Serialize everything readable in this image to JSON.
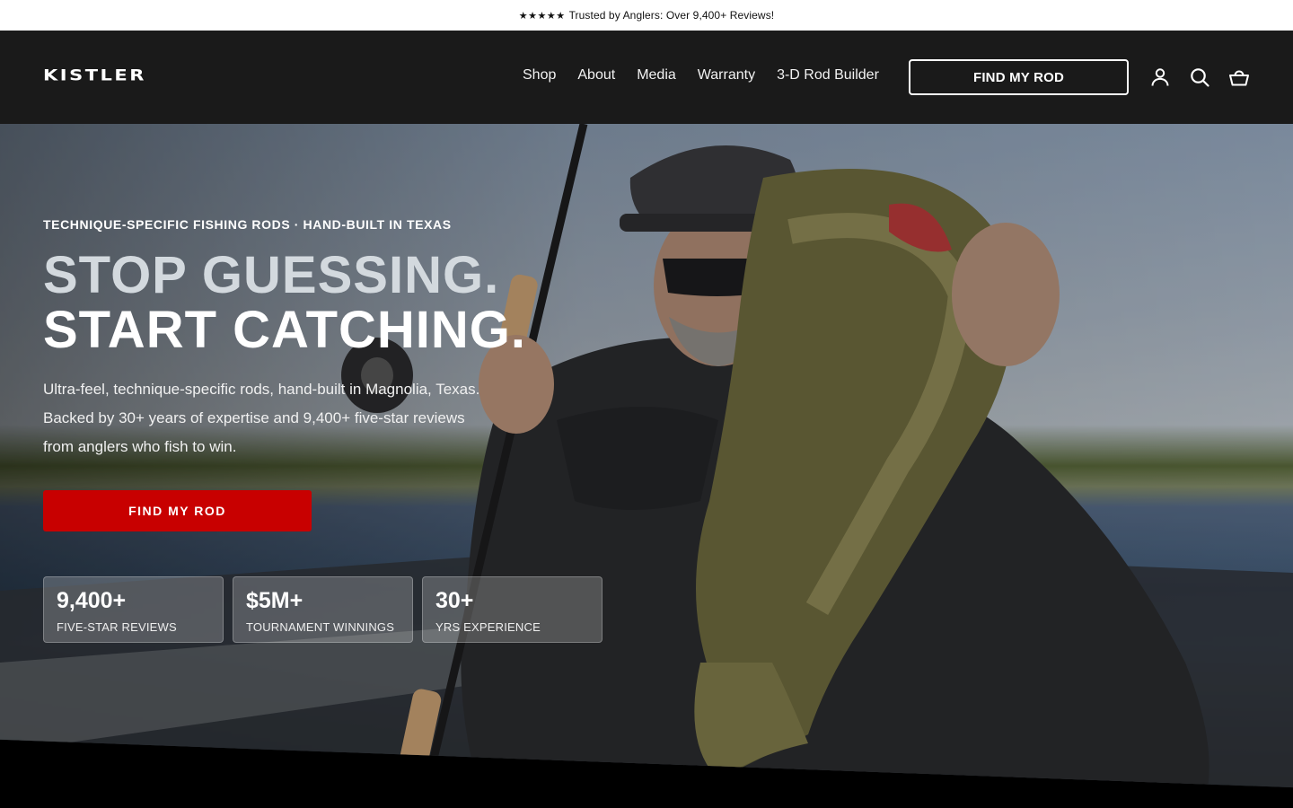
{
  "announcement": {
    "stars": "★★★★★",
    "text": "Trusted by Anglers: Over 9,400+ Reviews!"
  },
  "header": {
    "logo": "KISTLER",
    "nav": [
      {
        "label": "Shop"
      },
      {
        "label": "About"
      },
      {
        "label": "Media"
      },
      {
        "label": "Warranty"
      },
      {
        "label": "3-D Rod Builder"
      }
    ],
    "cta_label": "FIND MY ROD",
    "icons": [
      "account-icon",
      "search-icon",
      "cart-icon"
    ]
  },
  "hero": {
    "eyebrow": "TECHNIQUE-SPECIFIC FISHING RODS · HAND-BUILT IN TEXAS",
    "headline_line1": "STOP GUESSING.",
    "headline_line2": "START CATCHING.",
    "body": "Ultra-feel, technique-specific rods, hand-built in Magnolia, Texas. Backed by 30+ years of expertise and 9,400+ five-star reviews from anglers who fish to win.",
    "cta_label": "FIND MY ROD",
    "stats": [
      {
        "number": "9,400+",
        "label": "FIVE-STAR REVIEWS"
      },
      {
        "number": "$5M+",
        "label": "TOURNAMENT WINNINGS"
      },
      {
        "number": "30+",
        "label": "YRS EXPERIENCE"
      }
    ]
  },
  "colors": {
    "header_bg": "#1a1a1a",
    "cta_red": "#c80000",
    "announcement_bg": "#ffffff"
  }
}
